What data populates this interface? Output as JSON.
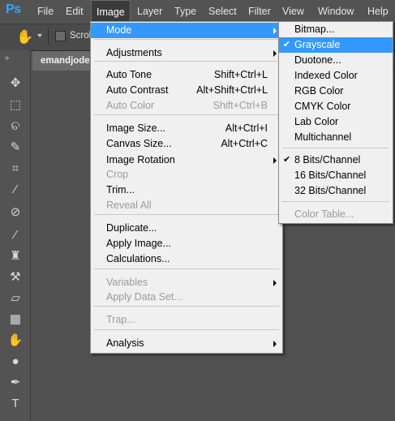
{
  "app": {
    "logo": "Ps"
  },
  "menubar": {
    "items": [
      "File",
      "Edit",
      "Image",
      "Layer",
      "Type",
      "Select",
      "Filter",
      "View",
      "Window",
      "Help"
    ],
    "active": "Image"
  },
  "options": {
    "scroll_label": "Scroll"
  },
  "document": {
    "tab_title": "emandjodes"
  },
  "image_menu": {
    "items": [
      {
        "label": "Mode",
        "shortcut": "",
        "submenu": true,
        "state": "highlighted"
      },
      {
        "label": "Adjustments",
        "shortcut": "",
        "submenu": true
      },
      {
        "label": "Auto Tone",
        "shortcut": "Shift+Ctrl+L"
      },
      {
        "label": "Auto Contrast",
        "shortcut": "Alt+Shift+Ctrl+L"
      },
      {
        "label": "Auto Color",
        "shortcut": "Shift+Ctrl+B",
        "state": "disabled"
      },
      {
        "label": "Image Size...",
        "shortcut": "Alt+Ctrl+I"
      },
      {
        "label": "Canvas Size...",
        "shortcut": "Alt+Ctrl+C"
      },
      {
        "label": "Image Rotation",
        "shortcut": "",
        "submenu": true
      },
      {
        "label": "Crop",
        "shortcut": "",
        "state": "disabled"
      },
      {
        "label": "Trim...",
        "shortcut": ""
      },
      {
        "label": "Reveal All",
        "shortcut": "",
        "state": "disabled"
      },
      {
        "label": "Duplicate...",
        "shortcut": ""
      },
      {
        "label": "Apply Image...",
        "shortcut": ""
      },
      {
        "label": "Calculations...",
        "shortcut": ""
      },
      {
        "label": "Variables",
        "shortcut": "",
        "submenu": true,
        "state": "disabled"
      },
      {
        "label": "Apply Data Set...",
        "shortcut": "",
        "state": "disabled"
      },
      {
        "label": "Trap...",
        "shortcut": "",
        "state": "disabled"
      },
      {
        "label": "Analysis",
        "shortcut": "",
        "submenu": true
      }
    ]
  },
  "mode_menu": {
    "items": [
      {
        "label": "Bitmap..."
      },
      {
        "label": "Grayscale",
        "checked": true,
        "state": "highlighted"
      },
      {
        "label": "Duotone..."
      },
      {
        "label": "Indexed Color"
      },
      {
        "label": "RGB Color"
      },
      {
        "label": "CMYK Color"
      },
      {
        "label": "Lab Color"
      },
      {
        "label": "Multichannel"
      },
      {
        "label": "8 Bits/Channel",
        "checked": true
      },
      {
        "label": "16 Bits/Channel"
      },
      {
        "label": "32 Bits/Channel"
      },
      {
        "label": "Color Table...",
        "state": "disabled"
      }
    ],
    "check_glyph": "✔"
  },
  "tool_icons": [
    "move-icon",
    "marquee-icon",
    "lasso-icon",
    "quick-selection-icon",
    "crop-icon",
    "eyedropper-icon",
    "healing-brush-icon",
    "brush-icon",
    "clone-stamp-icon",
    "history-brush-icon",
    "eraser-icon",
    "gradient-icon",
    "blur-icon",
    "dodge-icon",
    "pen-icon",
    "type-icon"
  ],
  "tool_glyphs": [
    "✥",
    "⬚",
    "ଚ",
    "✎",
    "⌗",
    "⁄",
    "⊘",
    "⁄",
    "♜",
    "⚒",
    "▱",
    "▦",
    "✋",
    "●",
    "✒",
    "T"
  ]
}
